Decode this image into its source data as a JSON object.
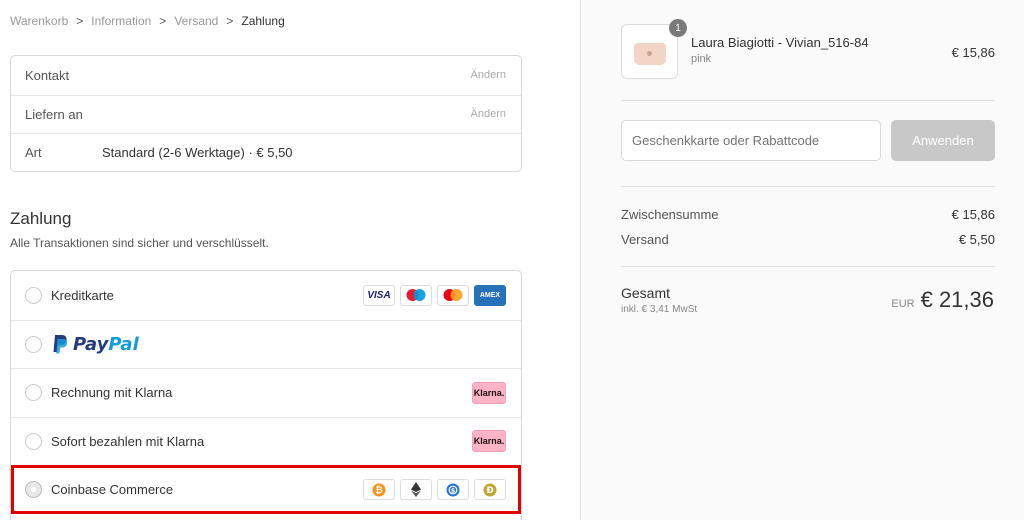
{
  "breadcrumb": {
    "items": [
      "Warenkorb",
      "Information",
      "Versand",
      "Zahlung"
    ],
    "separator": ">"
  },
  "review": {
    "rows": [
      {
        "label": "Kontakt",
        "value": "",
        "change": "Ändern"
      },
      {
        "label": "Liefern an",
        "value": "",
        "change": "Ändern"
      },
      {
        "label": "Art",
        "value": "Standard (2-6 Werktage) · € 5,50",
        "change": ""
      }
    ]
  },
  "payment": {
    "title": "Zahlung",
    "subtitle": "Alle Transaktionen sind sicher und verschlüsselt.",
    "methods": [
      {
        "label": "Kreditkarte",
        "badges": [
          "VISA",
          "maestro",
          "mastercard",
          "AMEX"
        ]
      },
      {
        "label": "PayPal",
        "logo_text_1": "Pay",
        "logo_text_2": "Pal"
      },
      {
        "label": "Rechnung mit Klarna",
        "badge": "Klarna."
      },
      {
        "label": "Sofort bezahlen mit Klarna",
        "badge": "Klarna."
      },
      {
        "label": "Coinbase Commerce",
        "badges": [
          "bitcoin",
          "ethereum",
          "usdc",
          "dogecoin"
        ],
        "selected": true
      }
    ]
  },
  "summary": {
    "product": {
      "quantity": "1",
      "name": "Laura Biagiotti - Vivian_516-84",
      "variant": "pink",
      "price": "€ 15,86"
    },
    "discount": {
      "placeholder": "Geschenkkarte oder Rabattcode",
      "button": "Anwenden"
    },
    "subtotal_label": "Zwischensumme",
    "subtotal_value": "€ 15,86",
    "shipping_label": "Versand",
    "shipping_value": "€ 5,50",
    "total_label": "Gesamt",
    "total_tax": "inkl. € 3,41 MwSt",
    "total_currency": "EUR",
    "total_value": "€ 21,36"
  },
  "colors": {
    "highlight": "#e30000",
    "klarna_pink": "#ffb3c7",
    "paypal_dark": "#253b80",
    "paypal_light": "#179bd7"
  }
}
